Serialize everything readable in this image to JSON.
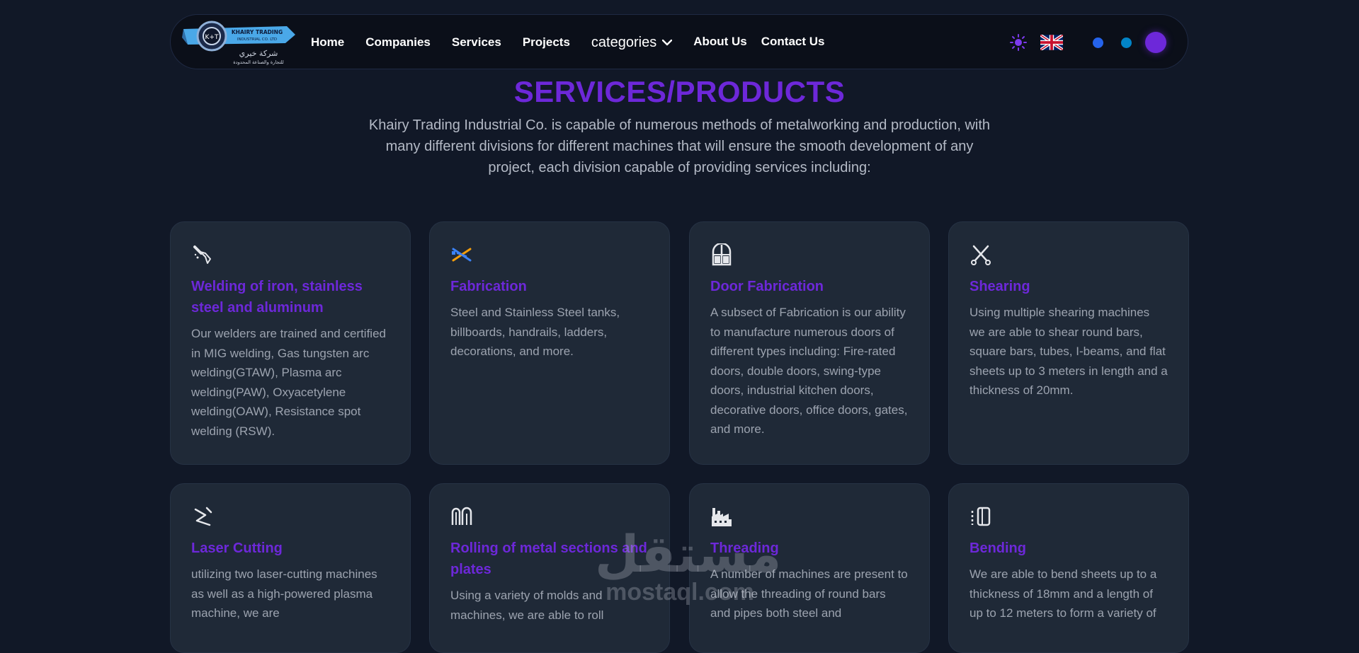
{
  "nav": {
    "logo_text": "KHAIRY TRADING INDUSTRIAL CO. LTD",
    "logo_arabic": "شركة خيري",
    "logo_arabic_sub": "للتجارة والصناعة المحدودة",
    "links": [
      "Home",
      "Companies",
      "Services",
      "Projects"
    ],
    "categories_label": "categories",
    "about_label": "About Us",
    "contact_label": "Contact Us"
  },
  "page": {
    "title": "SERVICES/PRODUCTS",
    "intro": "Khairy Trading Industrial Co. is capable of numerous methods of metalworking and production, with many different divisions for different machines that will ensure the smooth development of any project, each division capable of providing services including:"
  },
  "cards": [
    {
      "icon": "welding-torch-icon",
      "title": "Welding of iron, stainless steel and aluminum",
      "desc": "Our welders are trained and certified in MIG welding, Gas tungsten arc welding(GTAW), Plasma arc welding(PAW), Oxyacetylene welding(OAW), Resistance spot welding (RSW)."
    },
    {
      "icon": "fabrication-tools-icon",
      "title": "Fabrication",
      "desc": "Steel and Stainless Steel tanks, billboards, handrails, ladders, decorations, and more."
    },
    {
      "icon": "door-icon",
      "title": "Door Fabrication",
      "desc": "A subsect of Fabrication is our ability to manufacture numerous doors of different types including: Fire-rated doors, double doors, swing-type doors, industrial kitchen doors, decorative doors, office doors, gates, and more."
    },
    {
      "icon": "shears-icon",
      "title": "Shearing",
      "desc": "Using multiple shearing machines we are able to shear round bars, square bars, tubes, I-beams, and flat sheets up to 3 meters in length and a thickness of 20mm."
    },
    {
      "icon": "laser-cutter-icon",
      "title": "Laser Cutting",
      "desc": "utilizing two laser-cutting machines as well as a high-powered plasma machine, we are"
    },
    {
      "icon": "rolling-icon",
      "title": "Rolling of metal sections and plates",
      "desc": "Using a variety of molds and machines, we are able to roll"
    },
    {
      "icon": "factory-icon",
      "title": "Threading",
      "desc": "A number of machines are present to allow the threading of round bars and pipes both steel and"
    },
    {
      "icon": "bending-icon",
      "title": "Bending",
      "desc": "We are able to bend sheets up to a thickness of 18mm and a length of up to 12 meters to form a variety of"
    }
  ],
  "watermark": {
    "arabic": "مستقل",
    "latin": "mostaql.com"
  },
  "colors": {
    "accent": "#6d28d9",
    "background": "#111827",
    "card": "#1f2937"
  }
}
